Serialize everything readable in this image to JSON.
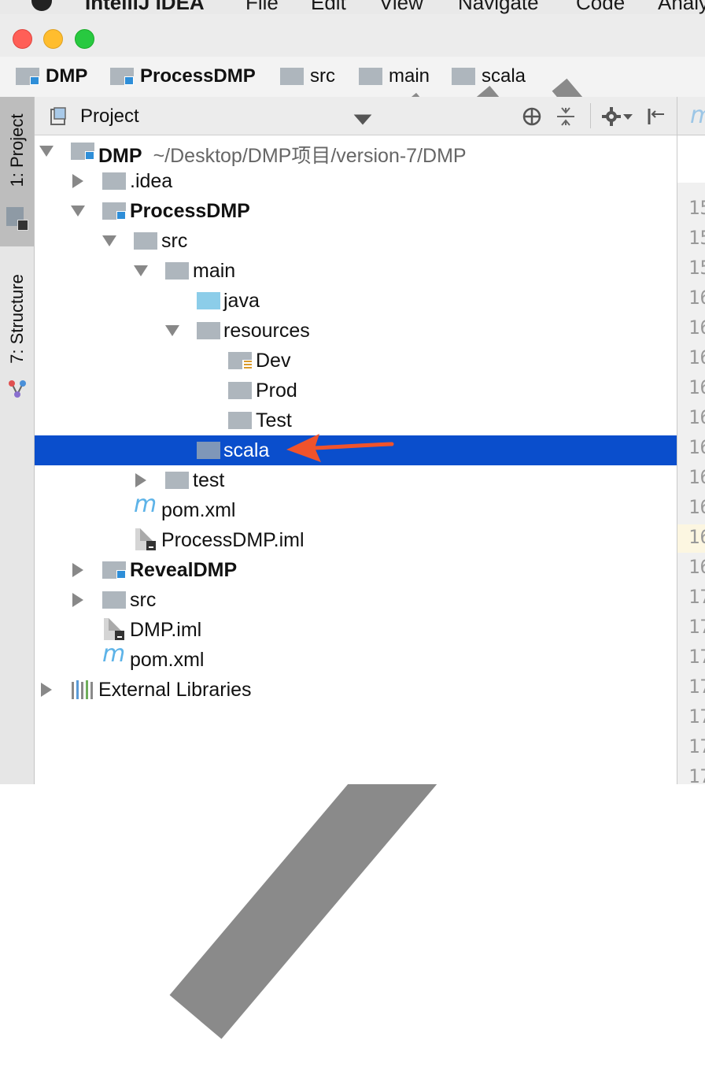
{
  "menubar": {
    "app_name": "IntelliJ IDEA",
    "items": [
      "File",
      "Edit",
      "View",
      "Navigate",
      "Code",
      "Analy"
    ]
  },
  "breadcrumbs": [
    "DMP",
    "ProcessDMP",
    "src",
    "main",
    "scala"
  ],
  "toolstrip": {
    "project_tab": "1: Project",
    "structure_tab": "7: Structure"
  },
  "project_panel": {
    "title": "Project"
  },
  "tree": {
    "root_name": "DMP",
    "root_path": "~/Desktop/DMP项目/version-7/DMP",
    "idea": ".idea",
    "processdmp": "ProcessDMP",
    "src": "src",
    "main": "main",
    "java": "java",
    "resources": "resources",
    "dev": "Dev",
    "prod": "Prod",
    "test_res": "Test",
    "scala": "scala",
    "test": "test",
    "pom1": "pom.xml",
    "iml1": "ProcessDMP.iml",
    "revealdmp": "RevealDMP",
    "src2": "src",
    "iml2": "DMP.iml",
    "pom2": "pom.xml",
    "external": "External Libraries"
  },
  "editor": {
    "tab_letter": "m",
    "line_numbers": [
      "15",
      "15",
      "15",
      "16",
      "16",
      "16",
      "16",
      "16",
      "16",
      "16",
      "16",
      "16",
      "16",
      "17",
      "17",
      "17",
      "17",
      "17",
      "17",
      "17"
    ]
  },
  "colors": {
    "selection": "#0a4ecc",
    "folder_gray": "#aeb6bd",
    "folder_blue": "#8ccde9",
    "module_blue": "#2e8ed8",
    "arrow": "#f0532b"
  }
}
